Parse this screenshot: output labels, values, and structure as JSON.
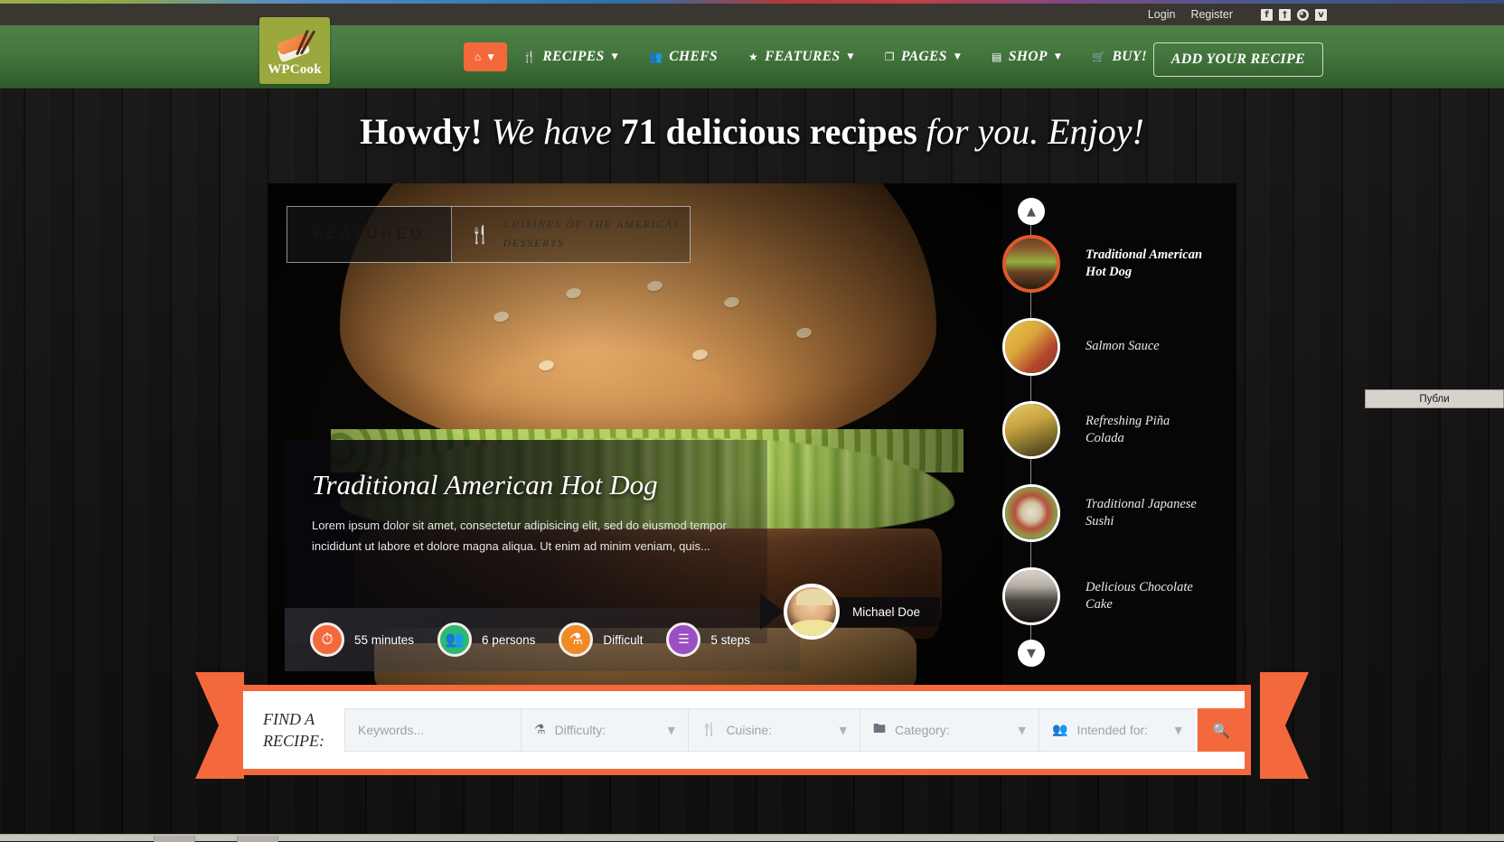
{
  "utility_bar": {
    "login_label": "Login",
    "register_label": "Register",
    "socials": [
      {
        "name": "facebook-icon",
        "glyph": "f"
      },
      {
        "name": "twitter-icon",
        "glyph": "ᵛ"
      },
      {
        "name": "dribbble-icon",
        "glyph": "⭘"
      },
      {
        "name": "vimeo-icon",
        "glyph": "v"
      }
    ]
  },
  "brand": {
    "name": "WPCook",
    "logo_bg": "#9aa83e"
  },
  "nav": {
    "home_icon": "home-icon",
    "items": [
      {
        "label": "RECIPES",
        "icon": "cutlery-icon",
        "glyph": "ἷ4",
        "caret": true
      },
      {
        "label": "CHEFS",
        "icon": "chef-group-icon",
        "glyph": "♟",
        "caret": false
      },
      {
        "label": "FEATURES",
        "icon": "star-icon",
        "glyph": "★",
        "caret": true
      },
      {
        "label": "PAGES",
        "icon": "pages-icon",
        "glyph": "❐",
        "caret": true
      },
      {
        "label": "SHOP",
        "icon": "shop-icon",
        "glyph": "▤",
        "caret": true
      },
      {
        "label": "BUY!",
        "icon": "cart-icon",
        "glyph": "Ὥ2",
        "caret": false
      }
    ],
    "cta_label": "ADD YOUR RECIPE",
    "accent_color": "#f4693c",
    "bar_color": "#44763e"
  },
  "headline": {
    "part1": "Howdy! ",
    "part2": "We have ",
    "count": "71 delicious recipes",
    "part3": " for you. Enjoy!"
  },
  "hero": {
    "featured_label": "FEATURED",
    "categories_line1": "CUISINES OF THE AMERICAS",
    "categories_line2": "DESSERTS",
    "cutlery_icon": "cutlery-icon",
    "recipe_title": "Traditional American Hot Dog",
    "recipe_excerpt": "Lorem ipsum dolor sit amet, consectetur adipisicing elit, sed do eiusmod tempor incididunt ut labore et dolore magna aliqua. Ut enim ad minim veniam, quis...",
    "meta": [
      {
        "icon": "clock-icon",
        "glyph": "⏱",
        "text": "55 minutes",
        "color": "#f4693c"
      },
      {
        "icon": "persons-icon",
        "glyph": "♟",
        "text": "6 persons",
        "color": "#2eb872"
      },
      {
        "icon": "difficulty-flask-icon",
        "glyph": "⚗",
        "text": "Difficult",
        "color": "#f08a24"
      },
      {
        "icon": "steps-list-icon",
        "glyph": "☰",
        "text": "5 steps",
        "color": "#9b4fc4"
      }
    ],
    "author_name": "Michael Doe",
    "author_avatar": "avatar"
  },
  "rail": {
    "up_icon": "chevron-up-icon",
    "down_icon": "chevron-down-icon",
    "items": [
      {
        "label": "Traditional American Hot Dog",
        "art": "burger",
        "active": true
      },
      {
        "label": "Salmon Sauce",
        "art": "salmon",
        "active": false
      },
      {
        "label": "Refreshing Piña Colada",
        "art": "pina",
        "active": false
      },
      {
        "label": "Traditional Japanese Sushi",
        "art": "sushi",
        "active": false
      },
      {
        "label": "Delicious Chocolate Cake",
        "art": "cake",
        "active": false
      }
    ]
  },
  "search": {
    "title_line1": "FIND A",
    "title_line2": "RECIPE:",
    "keywords_placeholder": "Keywords...",
    "keywords_value": "",
    "difficulty_label": "Difficulty:",
    "cuisine_label": "Cuisine:",
    "category_label": "Category:",
    "intended_label": "Intended for:",
    "difficulty_icon": "flask-icon",
    "cuisine_icon": "cutlery-icon",
    "category_icon": "folder-icon",
    "intended_icon": "persons-icon",
    "submit_icon": "search-icon",
    "accent_color": "#f4693c"
  },
  "os": {
    "tooltip_text": "Публи"
  }
}
